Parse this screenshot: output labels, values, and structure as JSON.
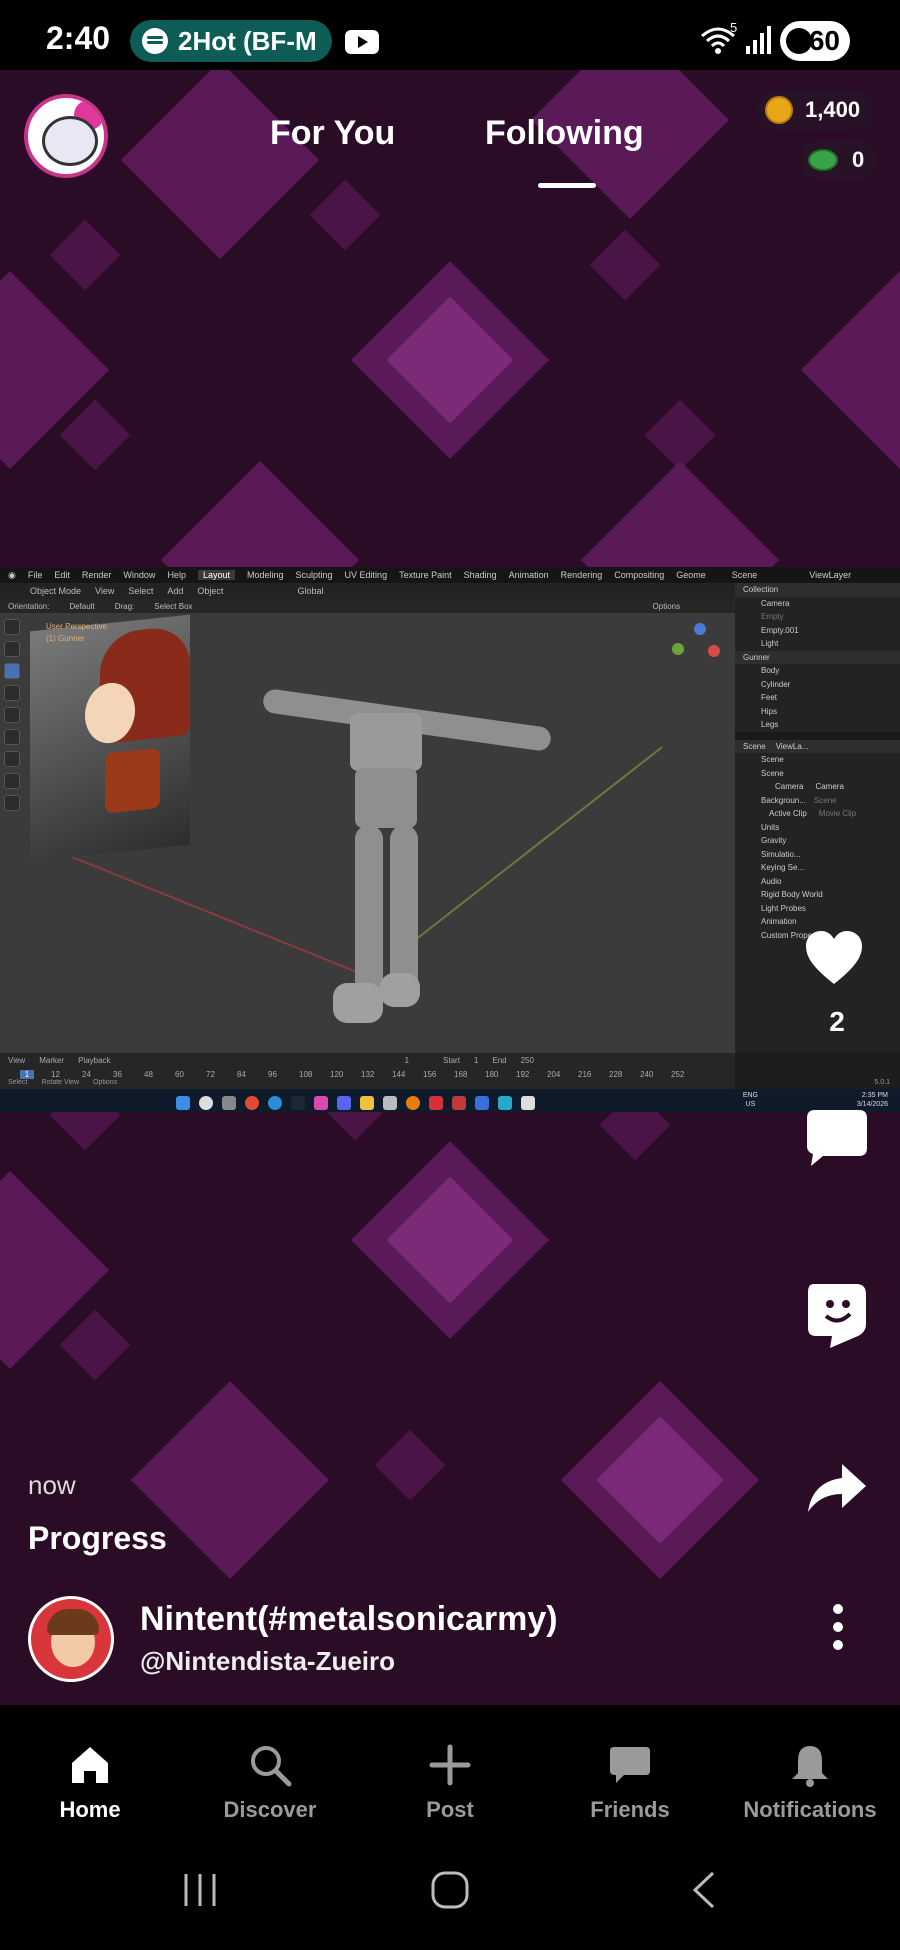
{
  "status_bar": {
    "time": "2:40",
    "media_label": "2Hot (BF-M",
    "battery": "60",
    "wifi_badge": "5"
  },
  "header": {
    "tabs": [
      {
        "label": "For You",
        "active": false
      },
      {
        "label": "Following",
        "active": true
      }
    ],
    "coins": "1,400",
    "gems": "0"
  },
  "blender": {
    "menu": [
      "File",
      "Edit",
      "Render",
      "Window",
      "Help",
      "Layout",
      "Modeling",
      "Sculpting",
      "UV Editing",
      "Texture Paint",
      "Shading",
      "Animation",
      "Rendering",
      "Compositing",
      "Geome"
    ],
    "active_workspace": "Layout",
    "scene_label": "Scene",
    "view_layer_label": "ViewLayer",
    "toolbar": [
      "Object Mode",
      "View",
      "Select",
      "Add",
      "Object",
      "Global"
    ],
    "orientation_row": [
      "Orientation:",
      "Default",
      "Drag:",
      "Select Box",
      "Options"
    ],
    "viewport_label_line1": "User Perspective",
    "viewport_label_line2": "(1) Gunner",
    "outliner": [
      "Collection",
      "Camera",
      "Empty",
      "Empty.001",
      "Light",
      "Gunner",
      "Body",
      "Cylinder",
      "Feet",
      "Hips",
      "Legs"
    ],
    "properties": [
      "Scene",
      "ViewLa...",
      "Scene",
      "Scene",
      "Camera",
      "Camera",
      "Backgroun...",
      "Scene",
      "Active Clip",
      "Movie Clip",
      "Units",
      "Gravity",
      "Simulatio...",
      "Keying Se...",
      "Audio",
      "Rigid Body World",
      "Light Probes",
      "Animation",
      "Custom Properties"
    ],
    "timeline_row": [
      "View",
      "Marker",
      "Playback",
      "1",
      "Start",
      "1",
      "End",
      "250"
    ],
    "frame_numbers": [
      "1",
      "12",
      "24",
      "36",
      "48",
      "60",
      "72",
      "84",
      "96",
      "108",
      "120",
      "132",
      "144",
      "156",
      "168",
      "180",
      "192",
      "204",
      "216",
      "228",
      "240",
      "252"
    ],
    "status_row": [
      "Select",
      "Rotate View",
      "Options"
    ],
    "version": "5.0.1",
    "clock_lang": "ENG",
    "clock_region": "US",
    "clock_time": "2:35 PM",
    "clock_date": "3/14/2026"
  },
  "actions": {
    "like_count": "2"
  },
  "post": {
    "time": "now",
    "title": "Progress",
    "author_name": "Nintent(#metalsonicarmy)",
    "author_handle": "@Nintendista-Zueiro"
  },
  "bottom_nav": [
    {
      "label": "Home",
      "icon": "home-icon",
      "active": true
    },
    {
      "label": "Discover",
      "icon": "search-icon",
      "active": false
    },
    {
      "label": "Post",
      "icon": "plus-icon",
      "active": false
    },
    {
      "label": "Friends",
      "icon": "chat-icon",
      "active": false
    },
    {
      "label": "Notifications",
      "icon": "bell-icon",
      "active": false
    }
  ],
  "colors": {
    "background": "#2a0c26",
    "diamond": "#5a1a57",
    "accent_teal": "#0d5d56",
    "coin": "#e8a619",
    "gem": "#3aa34a"
  }
}
